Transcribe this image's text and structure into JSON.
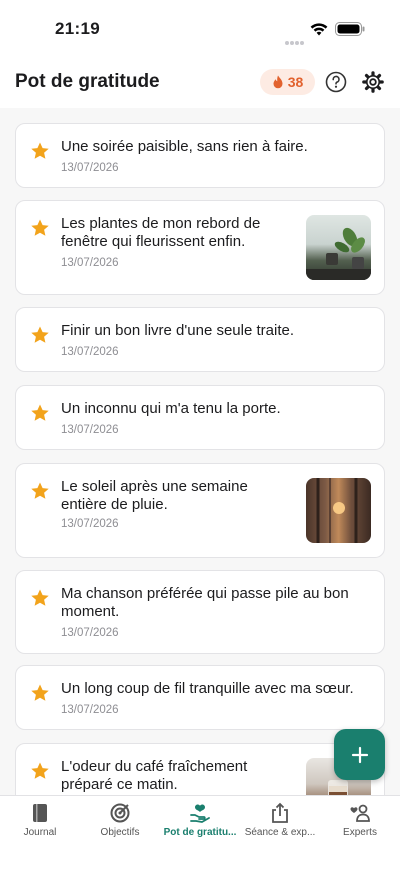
{
  "status": {
    "time": "21:19"
  },
  "header": {
    "title": "Pot de gratitude",
    "streak": "38"
  },
  "entries": [
    {
      "text": "Une soirée paisible, sans rien à faire.",
      "date": "13/07/2026"
    },
    {
      "text": "Les plantes de mon rebord de fenêtre qui fleurissent enfin.",
      "date": "13/07/2026"
    },
    {
      "text": "Finir un bon livre d'une seule traite.",
      "date": "13/07/2026"
    },
    {
      "text": "Un inconnu qui m'a tenu la porte.",
      "date": "13/07/2026"
    },
    {
      "text": "Le soleil après une semaine entière de pluie.",
      "date": "13/07/2026"
    },
    {
      "text": "Ma chanson préférée qui passe pile au bon moment.",
      "date": "13/07/2026"
    },
    {
      "text": "Un long coup de fil tranquille avec ma sœur.",
      "date": "13/07/2026"
    },
    {
      "text": "L'odeur du café fraîchement préparé ce matin.",
      "date": ""
    }
  ],
  "tabs": [
    {
      "label": "Journal",
      "icon": "book-icon"
    },
    {
      "label": "Objectifs",
      "icon": "target-icon"
    },
    {
      "label": "Pot de gratitu...",
      "icon": "heart-hand-icon"
    },
    {
      "label": "Séance & exp...",
      "icon": "share-icon"
    },
    {
      "label": "Experts",
      "icon": "experts-icon"
    }
  ],
  "colors": {
    "accent": "#1a7f6e",
    "star": "#f2a31b",
    "streak": "#e2622e"
  }
}
